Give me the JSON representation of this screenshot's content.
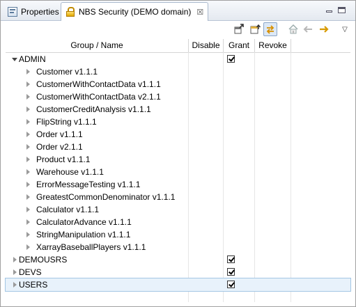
{
  "tabs": {
    "properties": {
      "label": "Properties"
    },
    "security": {
      "label": "NBS Security (DEMO domain)",
      "close": "☒"
    }
  },
  "toolbar": {
    "icons": [
      "export-icon",
      "import-icon",
      "refresh-icon",
      "home-icon",
      "back-icon",
      "forward-icon",
      "view-menu-icon"
    ],
    "view_menu_glyph": "▽"
  },
  "table": {
    "columns": [
      "Group / Name",
      "Disable",
      "Grant",
      "Revoke"
    ],
    "groups": [
      {
        "label": "ADMIN",
        "expanded": true,
        "grant": true,
        "children": [
          "Customer v1.1.1",
          "CustomerWithContactData v1.1.1",
          "CustomerWithContactData v2.1.1",
          "CustomerCreditAnalysis v1.1.1",
          "FlipString v1.1.1",
          "Order v1.1.1",
          "Order v2.1.1",
          "Product v1.1.1",
          "Warehouse v1.1.1",
          "ErrorMessageTesting v1.1.1",
          "GreatestCommonDenominator v1.1.1",
          "Calculator v1.1.1",
          "CalculatorAdvance v1.1.1",
          "StringManipulation v1.1.1",
          "XarrayBaseballPlayers v1.1.1"
        ]
      },
      {
        "label": "DEMOUSRS",
        "expanded": false,
        "grant": true,
        "children": []
      },
      {
        "label": "DEVS",
        "expanded": false,
        "grant": true,
        "children": []
      },
      {
        "label": "USERS",
        "expanded": false,
        "grant": true,
        "selected": true,
        "children": []
      }
    ]
  }
}
